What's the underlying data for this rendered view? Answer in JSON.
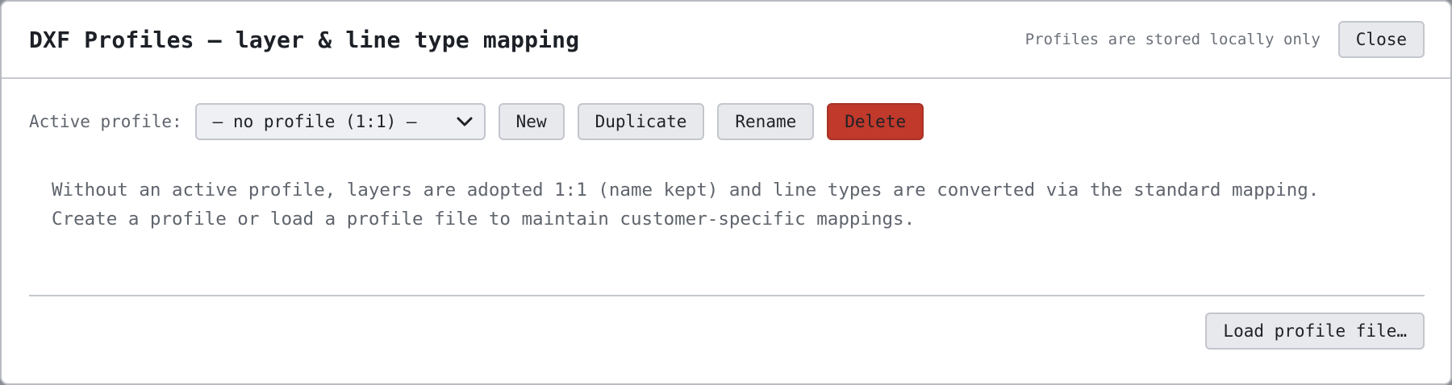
{
  "dialog": {
    "title": "DXF Profiles – layer & line type mapping",
    "storage_note": "Profiles are stored locally only",
    "close_label": "Close"
  },
  "toolbar": {
    "active_profile_label": "Active profile:",
    "selected_profile": "– no profile (1:1) –",
    "new_label": "New",
    "duplicate_label": "Duplicate",
    "rename_label": "Rename",
    "delete_label": "Delete"
  },
  "info": {
    "line1": "Without an active profile, layers are adopted 1:1 (name kept) and line types are converted via the standard mapping.",
    "line2": "Create a profile or load a profile file to maintain customer-specific mappings."
  },
  "footer": {
    "load_label": "Load profile file…"
  },
  "icons": {
    "select_chevron": "chevron-down-icon"
  },
  "colors": {
    "danger": "#c0392b",
    "button_bg": "#e8e9ec",
    "text_muted": "#5f646d"
  }
}
